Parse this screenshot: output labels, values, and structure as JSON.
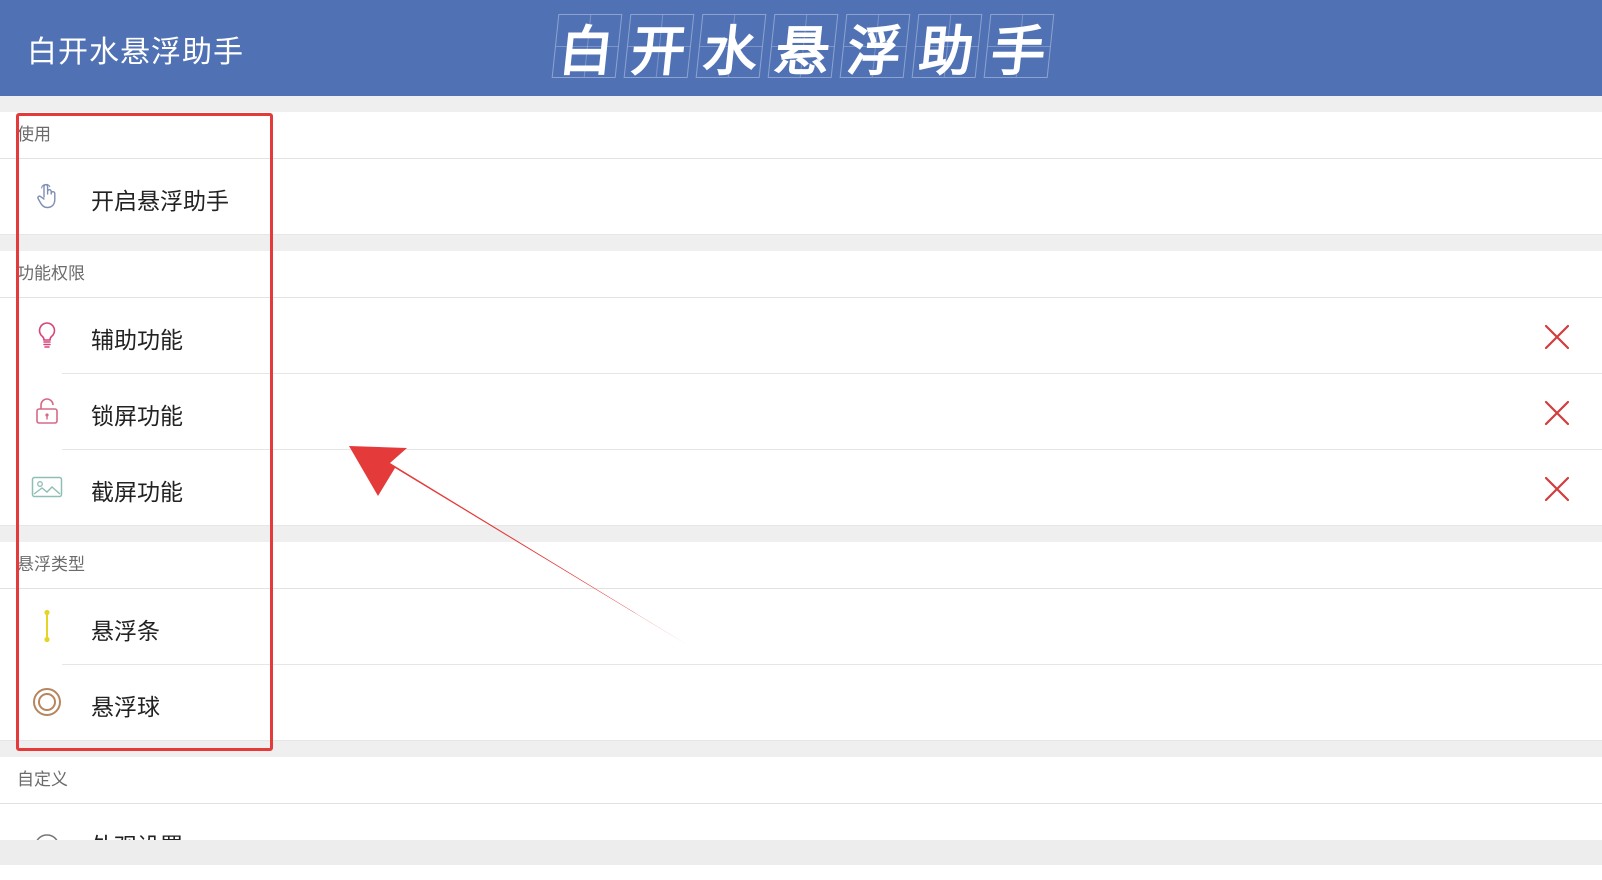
{
  "header": {
    "app_title": "白开水悬浮助手",
    "brand_chars": [
      "白",
      "开",
      "水",
      "悬",
      "浮",
      "助",
      "手"
    ]
  },
  "sections": [
    {
      "title": "使用",
      "items": [
        {
          "label": "开启悬浮助手",
          "icon": "hand-pointer-icon"
        }
      ]
    },
    {
      "title": "功能权限",
      "items": [
        {
          "label": "辅助功能",
          "icon": "lightbulb-icon",
          "status": "disabled"
        },
        {
          "label": "锁屏功能",
          "icon": "lock-icon",
          "status": "disabled"
        },
        {
          "label": "截屏功能",
          "icon": "image-icon",
          "status": "disabled"
        }
      ]
    },
    {
      "title": "悬浮类型",
      "items": [
        {
          "label": "悬浮条",
          "icon": "float-bar-icon"
        },
        {
          "label": "悬浮球",
          "icon": "float-ball-icon"
        }
      ]
    },
    {
      "title": "自定义",
      "items": [
        {
          "label": "外观设置",
          "icon": "appearance-icon"
        }
      ]
    }
  ],
  "colors": {
    "header_bg": "#5072b5",
    "status_x": "#d23c3c",
    "annotation_red": "#e53a3a"
  }
}
